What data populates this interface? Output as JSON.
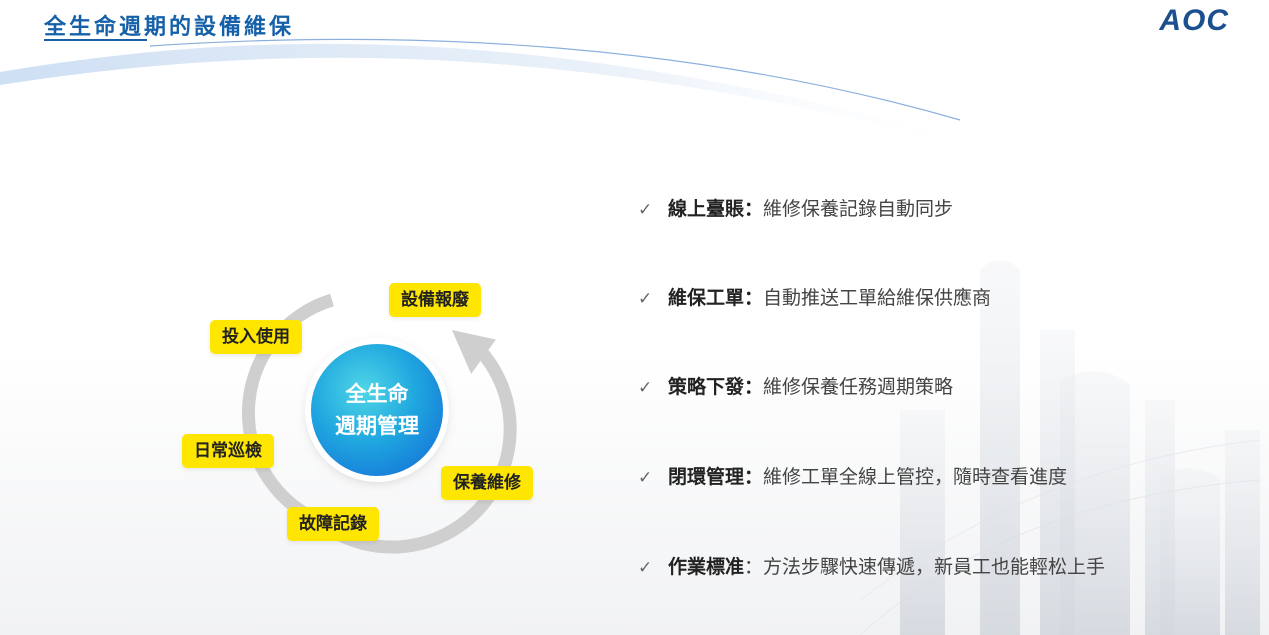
{
  "header": {
    "title": "全生命週期的設備維保",
    "logo": "AOC"
  },
  "cycle": {
    "center_line1": "全生命",
    "center_line2": "週期管理",
    "stages": [
      "設備報廢",
      "投入使用",
      "日常巡檢",
      "故障記錄",
      "保養維修"
    ]
  },
  "features": [
    {
      "check": "✓",
      "term": "線上臺賬",
      "sep": "：",
      "desc": "維修保養記錄自動同步"
    },
    {
      "check": "✓",
      "term": "維保工單",
      "sep": "：",
      "desc": "自動推送工單給維保供應商"
    },
    {
      "check": "✓",
      "term": "策略下發",
      "sep": "：",
      "desc": "維修保養任務週期策略"
    },
    {
      "check": "✓",
      "term": "閉環管理",
      "sep": "：",
      "desc": "維修工單全線上管控，隨時查看進度"
    },
    {
      "check": "✓",
      "term": "作業標准",
      "sep": "：",
      "desc": "方法步驟快速傳遞，新員工也能輕松上手"
    }
  ],
  "colors": {
    "title_blue": "#1560a8",
    "tag_yellow": "#ffe600",
    "arrow_gray": "#cfcfcf"
  }
}
